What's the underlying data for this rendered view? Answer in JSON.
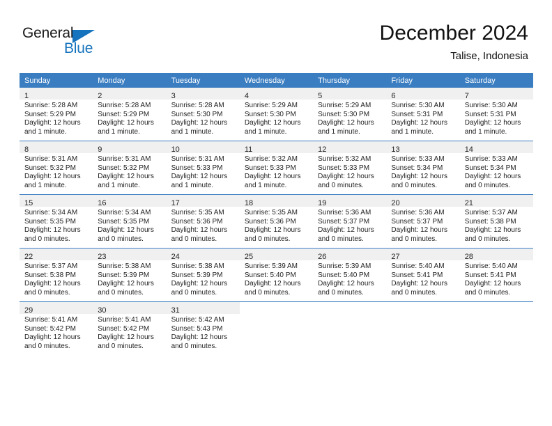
{
  "brand": {
    "name_top": "General",
    "name_bottom": "Blue",
    "accent_color": "#1673bd"
  },
  "header": {
    "title": "December 2024",
    "subtitle": "Talise, Indonesia"
  },
  "calendar": {
    "header_bg": "#3a7dc1",
    "cell_band_bg": "#f0f0f0",
    "weekday_headers": [
      "Sunday",
      "Monday",
      "Tuesday",
      "Wednesday",
      "Thursday",
      "Friday",
      "Saturday"
    ],
    "weeks": [
      [
        {
          "day": "1",
          "lines": [
            "Sunrise: 5:28 AM",
            "Sunset: 5:29 PM",
            "Daylight: 12 hours",
            "and 1 minute."
          ]
        },
        {
          "day": "2",
          "lines": [
            "Sunrise: 5:28 AM",
            "Sunset: 5:29 PM",
            "Daylight: 12 hours",
            "and 1 minute."
          ]
        },
        {
          "day": "3",
          "lines": [
            "Sunrise: 5:28 AM",
            "Sunset: 5:30 PM",
            "Daylight: 12 hours",
            "and 1 minute."
          ]
        },
        {
          "day": "4",
          "lines": [
            "Sunrise: 5:29 AM",
            "Sunset: 5:30 PM",
            "Daylight: 12 hours",
            "and 1 minute."
          ]
        },
        {
          "day": "5",
          "lines": [
            "Sunrise: 5:29 AM",
            "Sunset: 5:30 PM",
            "Daylight: 12 hours",
            "and 1 minute."
          ]
        },
        {
          "day": "6",
          "lines": [
            "Sunrise: 5:30 AM",
            "Sunset: 5:31 PM",
            "Daylight: 12 hours",
            "and 1 minute."
          ]
        },
        {
          "day": "7",
          "lines": [
            "Sunrise: 5:30 AM",
            "Sunset: 5:31 PM",
            "Daylight: 12 hours",
            "and 1 minute."
          ]
        }
      ],
      [
        {
          "day": "8",
          "lines": [
            "Sunrise: 5:31 AM",
            "Sunset: 5:32 PM",
            "Daylight: 12 hours",
            "and 1 minute."
          ]
        },
        {
          "day": "9",
          "lines": [
            "Sunrise: 5:31 AM",
            "Sunset: 5:32 PM",
            "Daylight: 12 hours",
            "and 1 minute."
          ]
        },
        {
          "day": "10",
          "lines": [
            "Sunrise: 5:31 AM",
            "Sunset: 5:33 PM",
            "Daylight: 12 hours",
            "and 1 minute."
          ]
        },
        {
          "day": "11",
          "lines": [
            "Sunrise: 5:32 AM",
            "Sunset: 5:33 PM",
            "Daylight: 12 hours",
            "and 1 minute."
          ]
        },
        {
          "day": "12",
          "lines": [
            "Sunrise: 5:32 AM",
            "Sunset: 5:33 PM",
            "Daylight: 12 hours",
            "and 0 minutes."
          ]
        },
        {
          "day": "13",
          "lines": [
            "Sunrise: 5:33 AM",
            "Sunset: 5:34 PM",
            "Daylight: 12 hours",
            "and 0 minutes."
          ]
        },
        {
          "day": "14",
          "lines": [
            "Sunrise: 5:33 AM",
            "Sunset: 5:34 PM",
            "Daylight: 12 hours",
            "and 0 minutes."
          ]
        }
      ],
      [
        {
          "day": "15",
          "lines": [
            "Sunrise: 5:34 AM",
            "Sunset: 5:35 PM",
            "Daylight: 12 hours",
            "and 0 minutes."
          ]
        },
        {
          "day": "16",
          "lines": [
            "Sunrise: 5:34 AM",
            "Sunset: 5:35 PM",
            "Daylight: 12 hours",
            "and 0 minutes."
          ]
        },
        {
          "day": "17",
          "lines": [
            "Sunrise: 5:35 AM",
            "Sunset: 5:36 PM",
            "Daylight: 12 hours",
            "and 0 minutes."
          ]
        },
        {
          "day": "18",
          "lines": [
            "Sunrise: 5:35 AM",
            "Sunset: 5:36 PM",
            "Daylight: 12 hours",
            "and 0 minutes."
          ]
        },
        {
          "day": "19",
          "lines": [
            "Sunrise: 5:36 AM",
            "Sunset: 5:37 PM",
            "Daylight: 12 hours",
            "and 0 minutes."
          ]
        },
        {
          "day": "20",
          "lines": [
            "Sunrise: 5:36 AM",
            "Sunset: 5:37 PM",
            "Daylight: 12 hours",
            "and 0 minutes."
          ]
        },
        {
          "day": "21",
          "lines": [
            "Sunrise: 5:37 AM",
            "Sunset: 5:38 PM",
            "Daylight: 12 hours",
            "and 0 minutes."
          ]
        }
      ],
      [
        {
          "day": "22",
          "lines": [
            "Sunrise: 5:37 AM",
            "Sunset: 5:38 PM",
            "Daylight: 12 hours",
            "and 0 minutes."
          ]
        },
        {
          "day": "23",
          "lines": [
            "Sunrise: 5:38 AM",
            "Sunset: 5:39 PM",
            "Daylight: 12 hours",
            "and 0 minutes."
          ]
        },
        {
          "day": "24",
          "lines": [
            "Sunrise: 5:38 AM",
            "Sunset: 5:39 PM",
            "Daylight: 12 hours",
            "and 0 minutes."
          ]
        },
        {
          "day": "25",
          "lines": [
            "Sunrise: 5:39 AM",
            "Sunset: 5:40 PM",
            "Daylight: 12 hours",
            "and 0 minutes."
          ]
        },
        {
          "day": "26",
          "lines": [
            "Sunrise: 5:39 AM",
            "Sunset: 5:40 PM",
            "Daylight: 12 hours",
            "and 0 minutes."
          ]
        },
        {
          "day": "27",
          "lines": [
            "Sunrise: 5:40 AM",
            "Sunset: 5:41 PM",
            "Daylight: 12 hours",
            "and 0 minutes."
          ]
        },
        {
          "day": "28",
          "lines": [
            "Sunrise: 5:40 AM",
            "Sunset: 5:41 PM",
            "Daylight: 12 hours",
            "and 0 minutes."
          ]
        }
      ],
      [
        {
          "day": "29",
          "lines": [
            "Sunrise: 5:41 AM",
            "Sunset: 5:42 PM",
            "Daylight: 12 hours",
            "and 0 minutes."
          ]
        },
        {
          "day": "30",
          "lines": [
            "Sunrise: 5:41 AM",
            "Sunset: 5:42 PM",
            "Daylight: 12 hours",
            "and 0 minutes."
          ]
        },
        {
          "day": "31",
          "lines": [
            "Sunrise: 5:42 AM",
            "Sunset: 5:43 PM",
            "Daylight: 12 hours",
            "and 0 minutes."
          ]
        },
        null,
        null,
        null,
        null
      ]
    ]
  }
}
